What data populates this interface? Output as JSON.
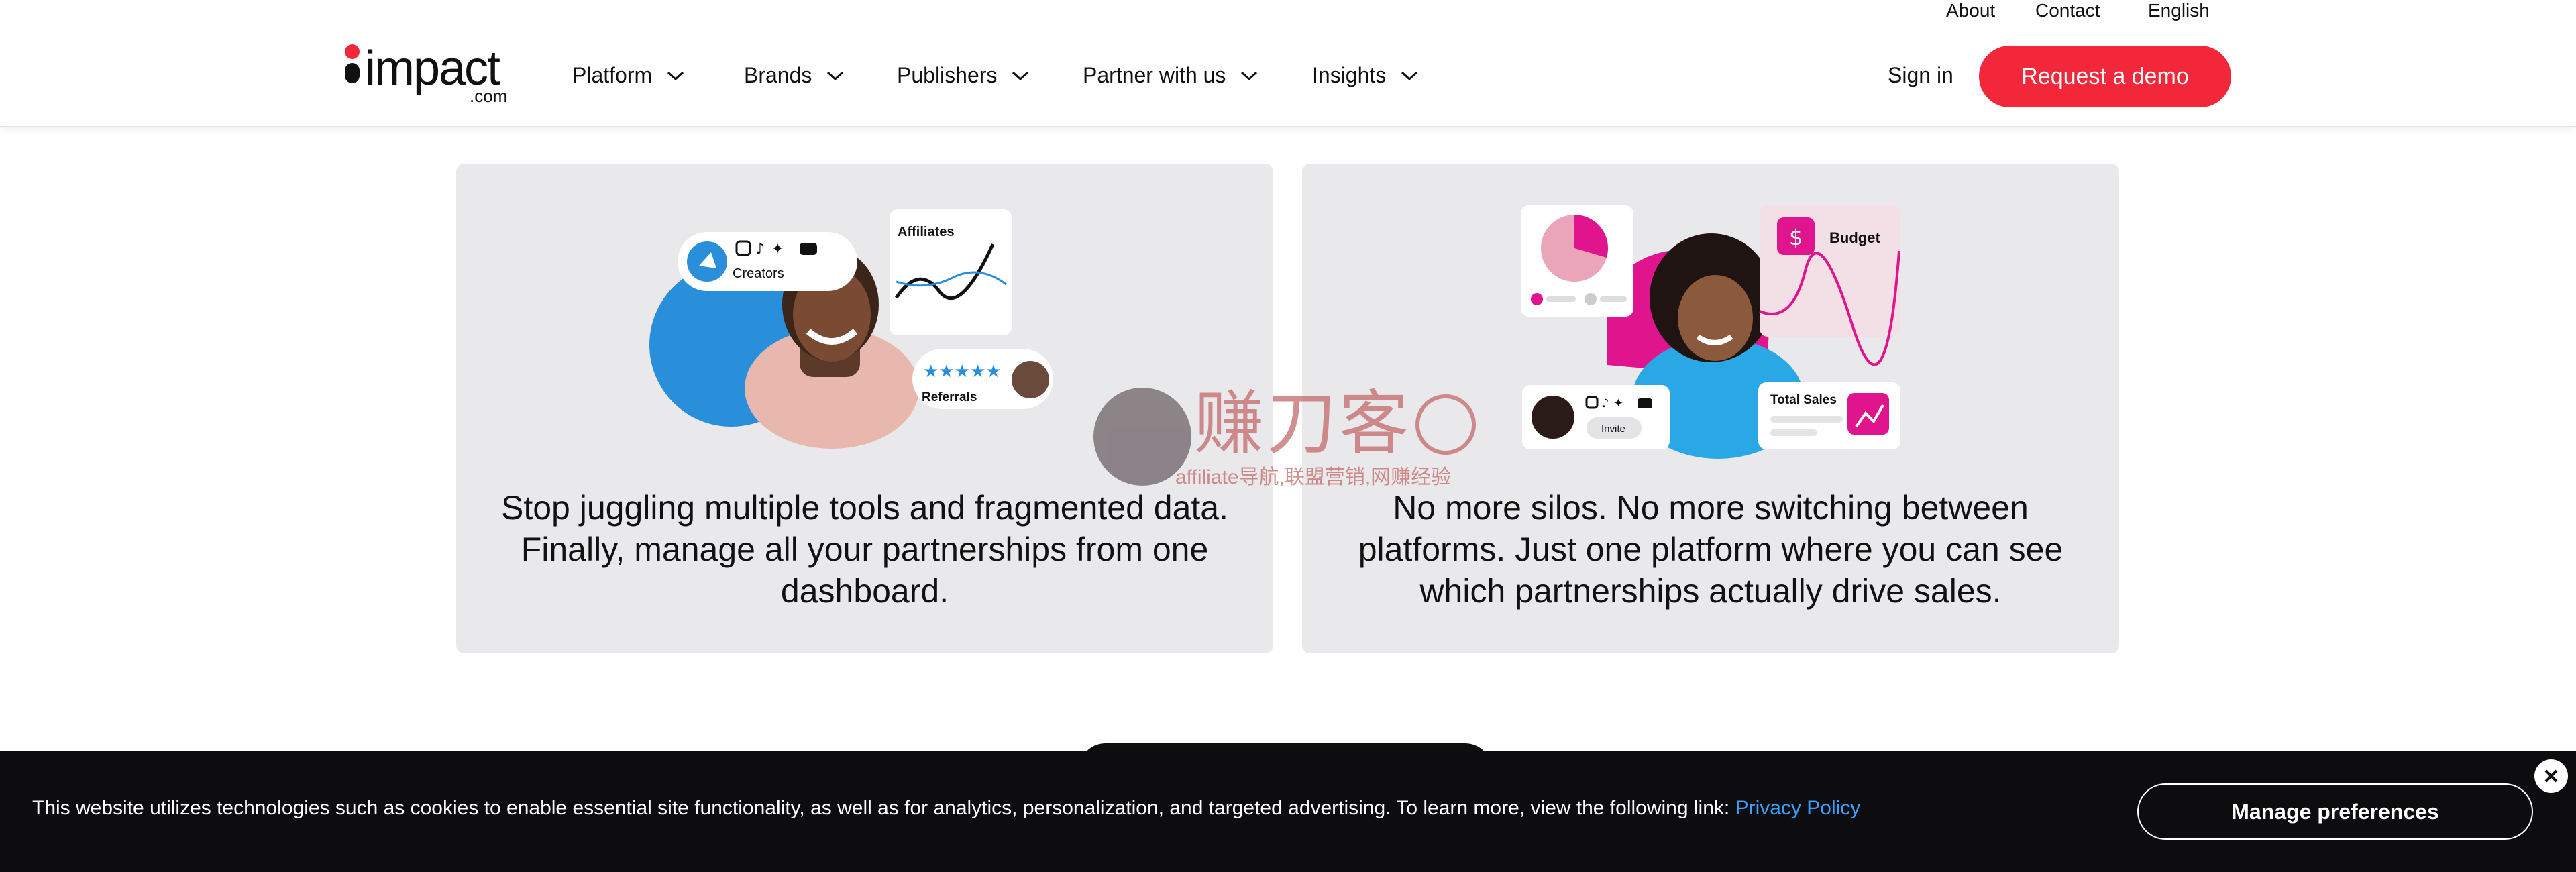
{
  "header": {
    "utility": [
      {
        "label": "About"
      },
      {
        "label": "Contact"
      },
      {
        "label": "English"
      }
    ],
    "logo": {
      "text": "impact",
      "sub": ".com",
      "dot_color": "#f2273a"
    },
    "nav": [
      {
        "label": "Platform",
        "icon": "chevron-down-icon"
      },
      {
        "label": "Brands",
        "icon": "chevron-down-icon"
      },
      {
        "label": "Publishers",
        "icon": "chevron-down-icon"
      },
      {
        "label": "Partner with us",
        "icon": "chevron-down-icon"
      },
      {
        "label": "Insights",
        "icon": "chevron-down-icon"
      }
    ],
    "sign_in": "Sign in",
    "demo_button": "Request a demo",
    "accent_color": "#f2273a"
  },
  "cards": [
    {
      "text": "Stop juggling multiple tools and fragmented data. Finally, manage all your partnerships from one dashboard.",
      "illustration": {
        "creators_label": "Creators",
        "affiliates_label": "Affiliates",
        "referrals_label": "Referrals",
        "accent_color": "#2a8fdb"
      }
    },
    {
      "text": "No more silos. No more switching between platforms. Just one platform where you can see which partnerships actually drive sales.",
      "illustration": {
        "budget_label": "Budget",
        "budget_symbol": "$",
        "total_sales_label": "Total Sales",
        "invite_label": "Invite",
        "accent_color": "#e0148c"
      }
    }
  ],
  "watermark": {
    "cn": "赚刀客",
    "sub": "affiliate导航,联盟营销,网赚经验"
  },
  "cookie_banner": {
    "text": "This website utilizes technologies such as cookies to enable essential site functionality, as well as for analytics, personalization, and targeted advertising. To learn more, view the following link: ",
    "link": "Privacy Policy",
    "manage_button": "Manage preferences",
    "close_icon": "close-icon"
  }
}
